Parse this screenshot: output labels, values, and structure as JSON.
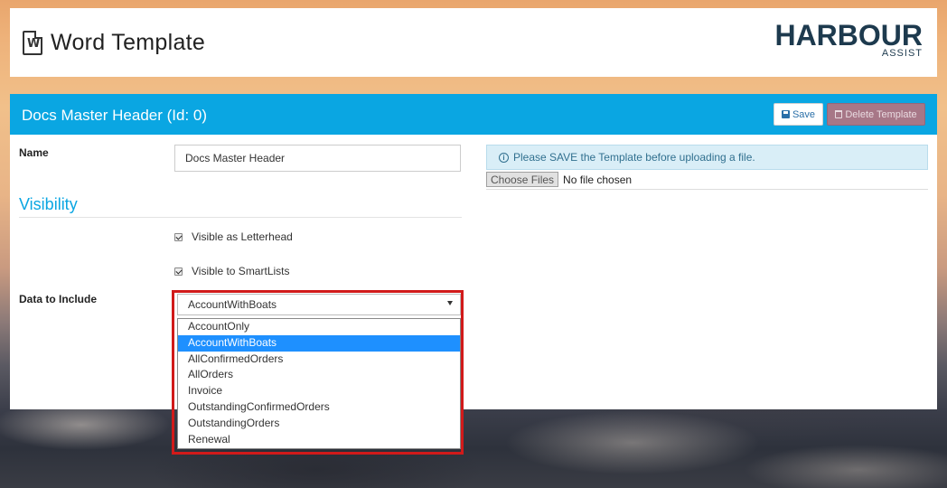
{
  "header": {
    "title": "Word Template",
    "icon": "word-document-icon",
    "icon_letter": "W",
    "logo_text": "HARBOUR",
    "logo_sub": "ASSIST"
  },
  "panel": {
    "title": "Docs Master Header (Id: 0)",
    "save_label": "Save",
    "delete_label": "Delete Template",
    "accent_color": "#0aa6e2"
  },
  "form": {
    "name_label": "Name",
    "name_value": "Docs Master Header",
    "visibility_heading": "Visibility",
    "visible_letterhead_label": "Visible as Letterhead",
    "visible_letterhead_checked": true,
    "visible_smartlists_label": "Visible to SmartLists",
    "visible_smartlists_checked": true,
    "data_include_label": "Data to Include",
    "data_include_value": "AccountWithBoats",
    "data_include_options": [
      "AccountOnly",
      "AccountWithBoats",
      "AllConfirmedOrders",
      "AllOrders",
      "Invoice",
      "OutstandingConfirmedOrders",
      "OutstandingOrders",
      "Renewal"
    ],
    "selected_index": 1
  },
  "upload": {
    "info_text": "Please SAVE the Template before uploading a file.",
    "choose_label": "Choose Files",
    "file_status": "No file chosen"
  }
}
